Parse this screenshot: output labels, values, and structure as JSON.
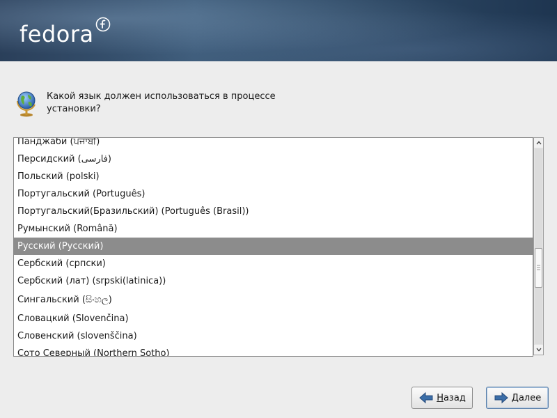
{
  "banner": {
    "logo_text": "fedora",
    "colors": {
      "bg_dark": "#2a3f5a",
      "bg_light": "#3c5a78"
    }
  },
  "question": {
    "line1": "Какой язык должен использоваться в процессе",
    "line2": "установки?",
    "icon": "globe-icon"
  },
  "languages": [
    {
      "label": "Панджаби (ਪੰਜਾਬੀ)"
    },
    {
      "label": "Персидский (فارسی)"
    },
    {
      "label": "Польский (polski)"
    },
    {
      "label": "Португальский (Português)"
    },
    {
      "label": "Португальский(Бразильский) (Português (Brasil))"
    },
    {
      "label": "Румынский (Română)"
    },
    {
      "label": "Русский (Русский)",
      "selected": true
    },
    {
      "label": "Сербский (српски)"
    },
    {
      "label": "Сербский (лат) (srpski(latinica))"
    },
    {
      "label": "Сингальский (සිංහල)"
    },
    {
      "label": "Словацкий (Slovenčina)"
    },
    {
      "label": "Словенский (slovenščina)"
    },
    {
      "label": "Сото Северный (Northern Sotho)"
    }
  ],
  "scroll": {
    "position_fraction": 0.64
  },
  "buttons": {
    "back_prefix": "Н",
    "back_rest": "азад",
    "next_prefix": "Д",
    "next_rest": "алее",
    "arrow_color": "#3b6ea8"
  }
}
